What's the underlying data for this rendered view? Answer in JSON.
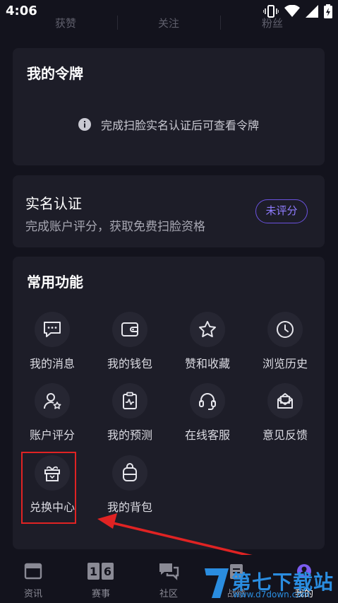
{
  "status_bar": {
    "time": "4:06"
  },
  "stats": {
    "likes": "获赞",
    "following": "关注",
    "fans": "粉丝"
  },
  "token_card": {
    "title": "我的令牌",
    "message": "完成扫脸实名认证后可查看令牌"
  },
  "realname_card": {
    "title": "实名认证",
    "subtitle": "完成账户评分，获取免费扫脸资格",
    "badge": "未评分"
  },
  "functions_card": {
    "title": "常用功能",
    "items": [
      {
        "label": "我的消息",
        "icon": "message-icon"
      },
      {
        "label": "我的钱包",
        "icon": "wallet-icon"
      },
      {
        "label": "赞和收藏",
        "icon": "star-icon"
      },
      {
        "label": "浏览历史",
        "icon": "clock-icon"
      },
      {
        "label": "账户评分",
        "icon": "user-rating-icon"
      },
      {
        "label": "我的预测",
        "icon": "prediction-icon"
      },
      {
        "label": "在线客服",
        "icon": "headset-icon"
      },
      {
        "label": "意见反馈",
        "icon": "feedback-icon"
      },
      {
        "label": "兑换中心",
        "icon": "gift-icon"
      },
      {
        "label": "我的背包",
        "icon": "backpack-icon"
      }
    ]
  },
  "bottom_nav": {
    "items": [
      {
        "label": "资讯",
        "icon": "news-icon"
      },
      {
        "label": "赛事",
        "icon": "match-icon",
        "icon_text": "16"
      },
      {
        "label": "社区",
        "icon": "community-icon"
      },
      {
        "label": "战绩",
        "icon": "record-icon"
      },
      {
        "label": "我的",
        "icon": "profile-icon"
      }
    ]
  },
  "watermark": {
    "text": "第七下载站",
    "url": "www.d7down.com"
  },
  "colors": {
    "background": "#13131d",
    "card": "#1d1d28",
    "accent": "#6b52e0",
    "highlight": "#e02323"
  }
}
